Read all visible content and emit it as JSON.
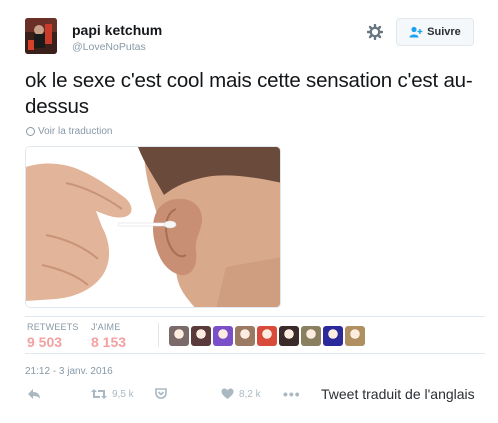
{
  "author": {
    "name": "papi ketchum",
    "handle": "@LoveNoPutas"
  },
  "follow_button": {
    "label": "Suivre",
    "icon": "add-person-icon"
  },
  "settings_icon": "gear-icon",
  "tweet": {
    "text": "ok le sexe c'est cool mais cette sensation c'est au-dessus",
    "translate_link": "Voir la traduction"
  },
  "media": {
    "description_icon": "photo-ear-cotton-swab"
  },
  "stats": {
    "retweets_label": "RETWEETS",
    "retweets_value": "9 503",
    "likes_label": "J'AIME",
    "likes_value": "8 153",
    "value_color": "#f4a1a1"
  },
  "liker_avatars": [
    {
      "color": "#7a6a6a"
    },
    {
      "color": "#5a3a3a"
    },
    {
      "color": "#7b4fc9"
    },
    {
      "color": "#9a7a62"
    },
    {
      "color": "#d84a3a"
    },
    {
      "color": "#3a2a2a"
    },
    {
      "color": "#8a8060"
    },
    {
      "color": "#2a2a9a"
    },
    {
      "color": "#b09060"
    }
  ],
  "timestamp": "21:12 - 3 janv. 2016",
  "actions": {
    "retweet_count": "9,5 k",
    "like_count": "8,2 k",
    "more": "•••",
    "translated_text": "Tweet traduit de l'anglais"
  },
  "colors": {
    "accent": "#1da1f2",
    "muted": "#8899a6",
    "icon_muted": "#aab8c2"
  }
}
